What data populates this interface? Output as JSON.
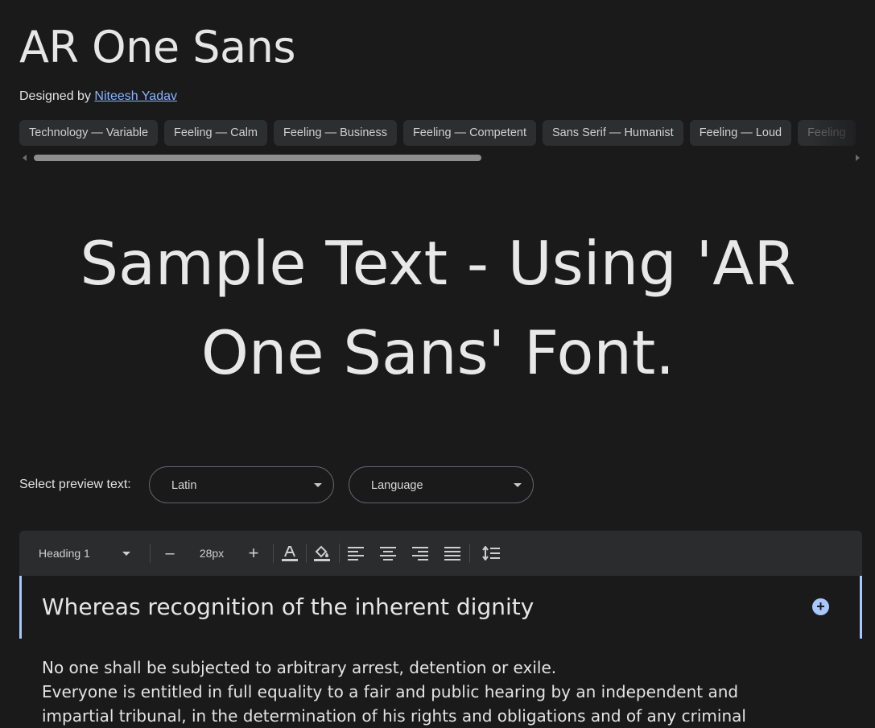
{
  "font": {
    "title": "AR One Sans",
    "designed_by_label": "Designed by",
    "designer": "Niteesh Yadav"
  },
  "tags": [
    "Technology — Variable",
    "Feeling — Calm",
    "Feeling — Business",
    "Feeling — Competent",
    "Sans Serif — Humanist",
    "Feeling — Loud",
    "Feeling"
  ],
  "sample_text": "Sample Text - Using 'AR One Sans' Font.",
  "preview": {
    "label": "Select preview text:",
    "script_value": "Latin",
    "language_placeholder": "Language"
  },
  "toolbar": {
    "style_value": "Heading 1",
    "minus": "–",
    "size_value": "28px",
    "plus": "+"
  },
  "editor": {
    "heading": "Whereas recognition of the inherent dignity",
    "add_symbol": "+",
    "lines": [
      "No one shall be subjected to arbitrary arrest, detention or exile.",
      "Everyone is entitled in full equality to a fair and public hearing by an independent and",
      "impartial tribunal, in the determination of his rights and obligations and of any criminal"
    ]
  },
  "colors": {
    "background": "#1a1a1b",
    "link": "#8ab4f8",
    "accent": "#a8c7fa",
    "chip": "#2d2e30",
    "toolbar": "#2b2c2e"
  }
}
